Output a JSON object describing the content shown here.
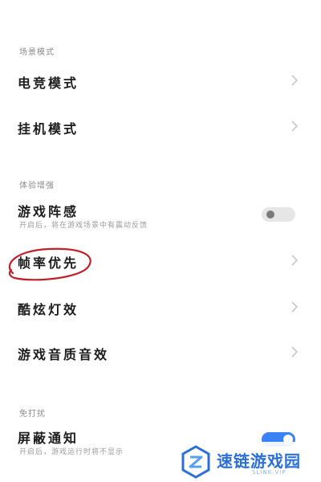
{
  "sections": {
    "scene": "场景模式",
    "experience": "体验增强",
    "do_not_disturb": "免打扰"
  },
  "rows": {
    "esports": {
      "title": "电竞模式"
    },
    "afk": {
      "title": "挂机模式"
    },
    "game_vibration": {
      "title": "游戏阵感",
      "subtitle": "开启后，将在游戏场景中有震动反馈",
      "toggle_state": "off"
    },
    "frame_rate": {
      "title": "帧率优先"
    },
    "breathing_light": {
      "title": "酷炫灯效"
    },
    "game_sound": {
      "title": "游戏音质音效"
    },
    "block_notifications": {
      "title": "屏蔽通知",
      "subtitle": "开启后，游戏运行时将不显示",
      "toggle_state": "on"
    },
    "partial_next": {
      "title": ""
    }
  },
  "watermark": {
    "text": "速链游戏园",
    "subtext": "SLINK.VIP"
  },
  "colors": {
    "annotation": "#c0202a",
    "toggle_on": "#3b82f6",
    "chevron": "#c8c8c8",
    "watermark": "#2b6fd8"
  }
}
